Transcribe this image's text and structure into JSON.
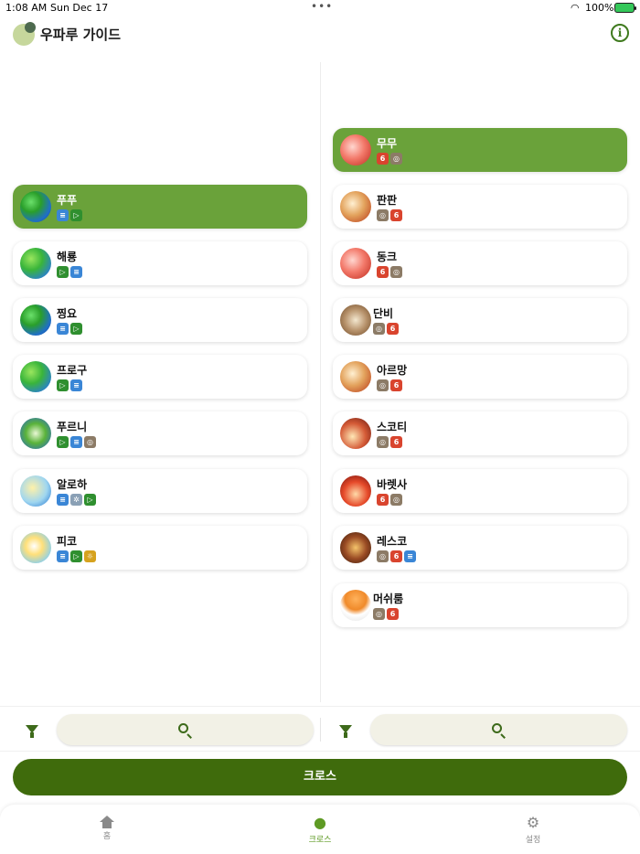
{
  "status_bar": {
    "time": "1:08 AM",
    "date": "Sun Dec 17",
    "dots": "•••",
    "battery": "100%"
  },
  "header": {
    "title": "우파루 가이드"
  },
  "left_list": [
    {
      "name": "푸푸",
      "badges": [
        "blue",
        "green"
      ],
      "selected": true
    },
    {
      "name": "해룡",
      "badges": [
        "green",
        "blue"
      ],
      "selected": false
    },
    {
      "name": "찡요",
      "badges": [
        "blue",
        "green"
      ],
      "selected": false
    },
    {
      "name": "프로구",
      "badges": [
        "green",
        "blue"
      ],
      "selected": false
    },
    {
      "name": "푸르니",
      "badges": [
        "green",
        "blue",
        "brown"
      ],
      "selected": false
    },
    {
      "name": "알로하",
      "badges": [
        "blue",
        "silver",
        "green"
      ],
      "selected": false
    },
    {
      "name": "피코",
      "badges": [
        "blue",
        "green",
        "yellow"
      ],
      "selected": false
    }
  ],
  "right_list": [
    {
      "name": "무무",
      "badges": [
        "red",
        "brown"
      ],
      "selected": true
    },
    {
      "name": "판판",
      "badges": [
        "brown",
        "red"
      ],
      "selected": false
    },
    {
      "name": "동크",
      "badges": [
        "red",
        "brown"
      ],
      "selected": false
    },
    {
      "name": "단비",
      "badges": [
        "brown",
        "red"
      ],
      "selected": false
    },
    {
      "name": "아르망",
      "badges": [
        "brown",
        "red"
      ],
      "selected": false
    },
    {
      "name": "스코티",
      "badges": [
        "brown",
        "red"
      ],
      "selected": false
    },
    {
      "name": "바렛사",
      "badges": [
        "red",
        "brown"
      ],
      "selected": false
    },
    {
      "name": "레스코",
      "badges": [
        "brown",
        "red",
        "blue"
      ],
      "selected": false
    },
    {
      "name": "머쉬룸",
      "badges": [
        "brown",
        "red"
      ],
      "selected": false
    }
  ],
  "actions": {
    "cross_label": "크로스"
  },
  "tabs": [
    {
      "label": "홈",
      "icon": "home-icon",
      "active": false
    },
    {
      "label": "크로스",
      "icon": "palette-icon",
      "active": true
    },
    {
      "label": "설정",
      "icon": "gear-icon",
      "active": false
    }
  ],
  "colors": {
    "accent": "#6aa23a",
    "button": "#3f6b0c",
    "tab_active": "#5e9a24"
  }
}
